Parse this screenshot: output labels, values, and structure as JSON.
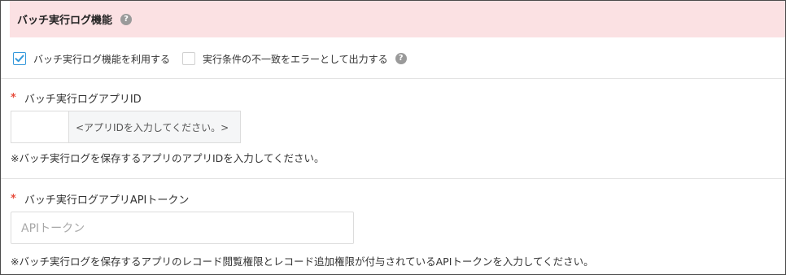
{
  "section": {
    "title": "バッチ実行ログ機能",
    "help_icon": "?"
  },
  "options": {
    "use_batch_log": {
      "label": "バッチ実行ログ機能を利用する",
      "checked": true
    },
    "mismatch_as_error": {
      "label": "実行条件の不一致をエラーとして出力する",
      "checked": false,
      "help_icon": "?"
    }
  },
  "app_id_field": {
    "required_mark": "*",
    "label": "バッチ実行ログアプリID",
    "value": "",
    "addon_text": "<アプリIDを入力してください。>",
    "note": "※バッチ実行ログを保存するアプリのアプリIDを入力してください。"
  },
  "api_token_field": {
    "required_mark": "*",
    "label": "バッチ実行ログアプリAPIトークン",
    "placeholder": "APIトークン",
    "note": "※バッチ実行ログを保存するアプリのレコード閲覧権限とレコード追加権限が付与されているAPIトークンを入力してください。"
  },
  "colors": {
    "header_bg": "#fbe1e3",
    "required": "#e74c3c",
    "checkbox_accent": "#3498db"
  }
}
